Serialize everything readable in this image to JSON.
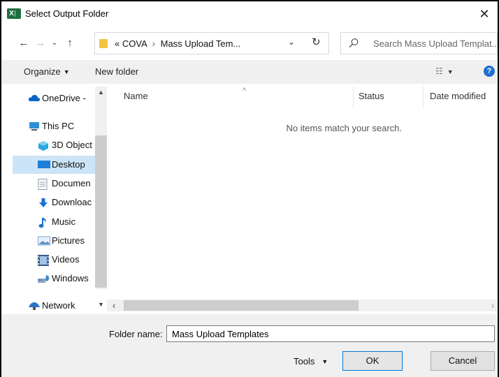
{
  "window": {
    "title": "Select Output Folder",
    "app_icon_letter": "X",
    "close_glyph": "✕"
  },
  "nav": {
    "back_glyph": "←",
    "forward_glyph": "→",
    "recent_glyph": "⌄",
    "up_glyph": "↑"
  },
  "address": {
    "overflow": "«",
    "segments": [
      "COVA",
      "Mass Upload Tem..."
    ],
    "separator": "›",
    "dropdown_glyph": "⌄",
    "refresh_glyph": "↻"
  },
  "search": {
    "placeholder": "Search Mass Upload Templat..."
  },
  "toolbar": {
    "organize_label": "Organize",
    "new_folder_label": "New folder",
    "view_glyph": "☷",
    "help_glyph": "?"
  },
  "sidebar": {
    "items": [
      {
        "label": "OneDrive -",
        "icon": "cloud-icon",
        "color": "#0a64c8"
      },
      {
        "label": "This PC",
        "icon": "computer-icon",
        "color": "#2d8fd5"
      },
      {
        "label": "3D Object",
        "icon": "cube-icon",
        "color": "#2aa6e0"
      },
      {
        "label": "Desktop",
        "icon": "desktop-icon",
        "color": "#1f7fd8",
        "selected": true
      },
      {
        "label": "Documen",
        "icon": "document-icon",
        "color": "#8c9aa8"
      },
      {
        "label": "Downloac",
        "icon": "download-icon",
        "color": "#1d6fd6"
      },
      {
        "label": "Music",
        "icon": "music-icon",
        "color": "#1a73c9"
      },
      {
        "label": "Pictures",
        "icon": "pictures-icon",
        "color": "#7fa9d4"
      },
      {
        "label": "Videos",
        "icon": "videos-icon",
        "color": "#3a5a8a"
      },
      {
        "label": "Windows",
        "icon": "drive-icon",
        "color": "#3a87c8"
      },
      {
        "label": "Network",
        "icon": "network-icon",
        "color": "#2a74c4"
      }
    ]
  },
  "file_list": {
    "columns": [
      "Name",
      "Status",
      "Date modified"
    ],
    "sort_glyph": "^",
    "empty_message": "No items match your search."
  },
  "bottom": {
    "folder_name_label": "Folder name:",
    "folder_name_value": "Mass Upload Templates",
    "tools_label": "Tools",
    "ok_label": "OK",
    "cancel_label": "Cancel"
  },
  "colors": {
    "selection": "#cce4f7",
    "accent": "#0078d7",
    "chrome": "#f0f0f0"
  }
}
